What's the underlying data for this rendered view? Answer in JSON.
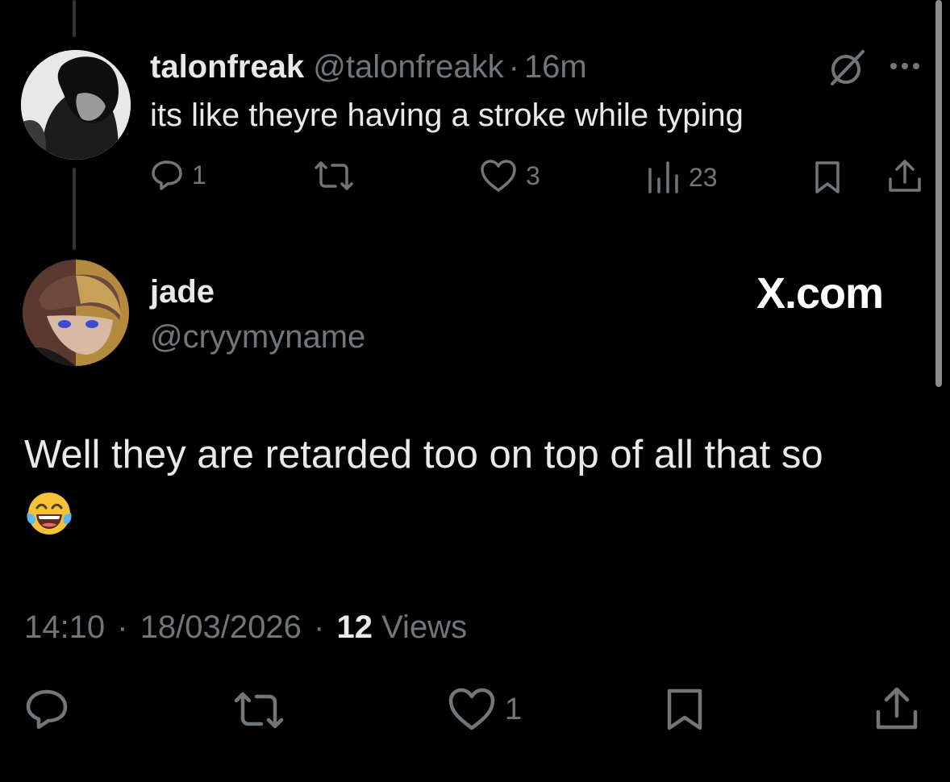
{
  "reply": {
    "display_name": "talonfreak",
    "handle": "@talonfreakk",
    "separator": "·",
    "time": "16m",
    "text": "its like theyre having a stroke while typing",
    "actions": {
      "replies": "1",
      "likes": "3",
      "views": "23"
    },
    "avatar_icon": "avatar-dark-anime-character",
    "grok_icon": "grok-icon",
    "more_icon": "more-dots-icon"
  },
  "main": {
    "display_name": "jade",
    "handle": "@cryymyname",
    "watermark": "X.com",
    "text": "Well they are retarded too on top of all that so",
    "emoji": "😂",
    "time": "14:10",
    "date": "18/03/2026",
    "separator": "·",
    "views_count": "12",
    "views_label": "Views",
    "actions": {
      "likes": "1"
    },
    "avatar_icon": "avatar-anime-character-brown-blond-hair"
  },
  "colors": {
    "background": "#000000",
    "text_primary": "#e7e9ea",
    "text_muted": "#71767b",
    "thread_line": "#333639"
  }
}
